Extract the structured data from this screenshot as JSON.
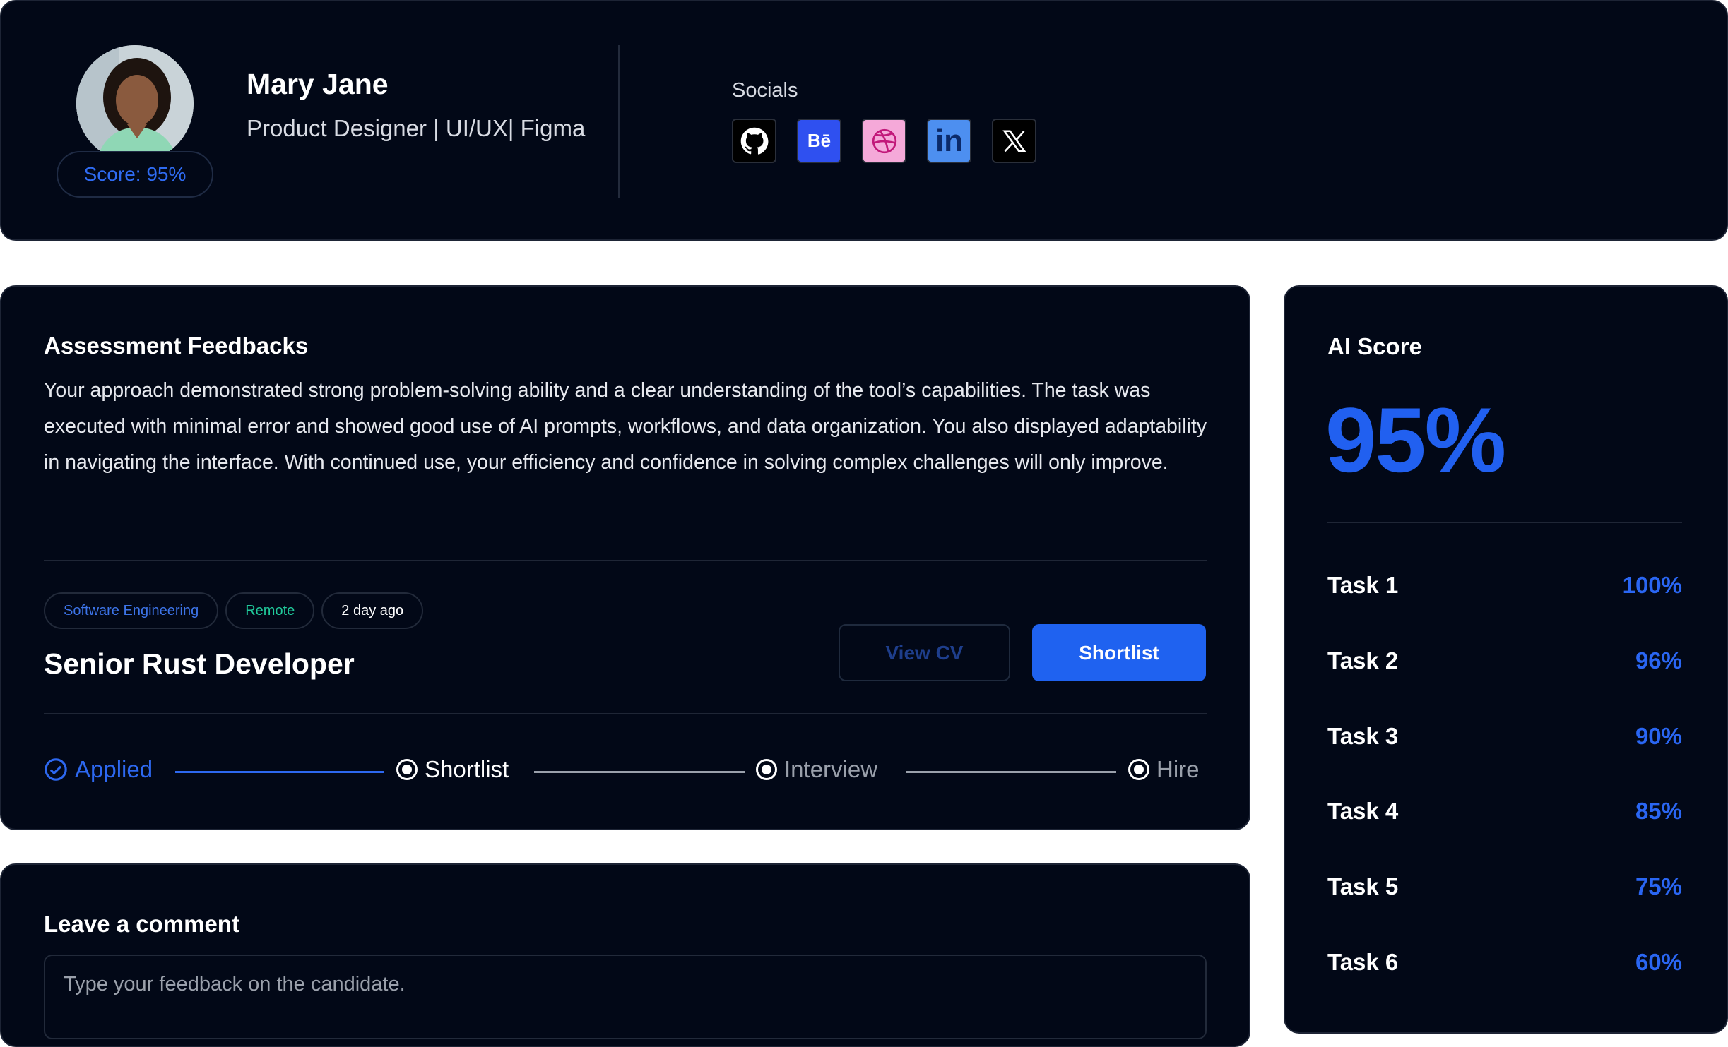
{
  "profile": {
    "name": "Mary Jane",
    "role": "Product Designer | UI/UX| Figma",
    "score_label": "Score: 95%",
    "socials_label": "Socials",
    "socials": [
      {
        "icon": "github-icon",
        "bg": "#000000"
      },
      {
        "icon": "behance-icon",
        "bg": "#2f50f0"
      },
      {
        "icon": "dribbble-icon",
        "bg": "#f5a9d9"
      },
      {
        "icon": "linkedin-icon",
        "bg": "#4d8ff0"
      },
      {
        "icon": "x-icon",
        "bg": "#000000"
      }
    ],
    "behance_text": "Bē",
    "linkedin_text": "in",
    "x_text": "X"
  },
  "feedback": {
    "title": "Assessment Feedbacks",
    "text": "Your approach demonstrated strong problem-solving ability and a clear understanding of the tool’s capabilities. The task was executed with minimal error and showed good use of AI prompts, workflows, and data organization. You also displayed adaptability in navigating the interface. With continued use, your efficiency and confidence in solving complex challenges will only improve."
  },
  "job": {
    "tags": [
      {
        "label": "Software Engineering",
        "color": "#3d74e8"
      },
      {
        "label": "Remote",
        "color": "#20c99a"
      },
      {
        "label": "2 day ago",
        "color": "#ffffff"
      }
    ],
    "title": "Senior Rust Developer",
    "view_cv_label": "View CV",
    "shortlist_label": "Shortlist"
  },
  "pipeline": {
    "steps": [
      {
        "label": "Applied",
        "state": "done"
      },
      {
        "label": "Shortlist",
        "state": "current"
      },
      {
        "label": "Interview",
        "state": "pending"
      },
      {
        "label": "Hire",
        "state": "pending"
      }
    ],
    "active_color": "#2d68f0",
    "pending_color": "#9aa0ab"
  },
  "ai_score": {
    "title": "AI Score",
    "value": "95%",
    "tasks": [
      {
        "label": "Task 1",
        "pct": "100%"
      },
      {
        "label": "Task 2",
        "pct": "96%"
      },
      {
        "label": "Task 3",
        "pct": "90%"
      },
      {
        "label": "Task 4",
        "pct": "85%"
      },
      {
        "label": "Task 5",
        "pct": "75%"
      },
      {
        "label": "Task 6",
        "pct": "60%"
      }
    ]
  },
  "comment": {
    "title": "Leave a comment",
    "placeholder": "Type your feedback on the candidate."
  }
}
